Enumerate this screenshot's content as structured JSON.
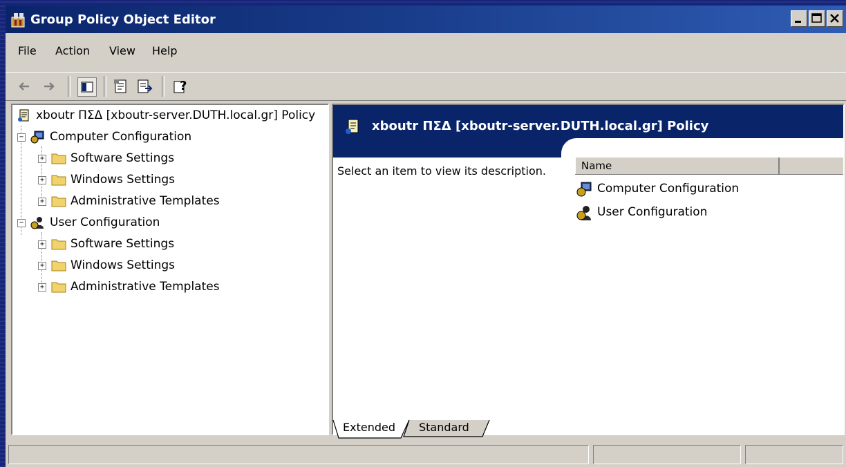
{
  "window": {
    "title": "Group Policy Object Editor"
  },
  "menu": {
    "file": "File",
    "action": "Action",
    "view": "View",
    "help": "Help"
  },
  "toolbar": {
    "buttons": [
      "back-arrow-icon",
      "forward-arrow-icon",
      "show-hide-tree-icon",
      "properties-icon",
      "export-list-icon",
      "help-icon"
    ]
  },
  "tree": {
    "root": "xboutr ΠΣΔ [xboutr-server.DUTH.local.gr] Policy",
    "computer": "Computer Configuration",
    "computer_children": [
      "Software Settings",
      "Windows Settings",
      "Administrative Templates"
    ],
    "user": "User Configuration",
    "user_children": [
      "Software Settings",
      "Windows Settings",
      "Administrative Templates"
    ]
  },
  "details": {
    "header": "xboutr ΠΣΔ [xboutr-server.DUTH.local.gr] Policy",
    "description": "Select an item to view its description.",
    "column_name": "Name",
    "items": [
      "Computer Configuration",
      "User Configuration"
    ]
  },
  "tabs": {
    "extended": "Extended",
    "standard": "Standard"
  },
  "colors": {
    "titlebar": "#0a246a",
    "face": "#d4d0c8",
    "folder": "#f2d36b"
  }
}
